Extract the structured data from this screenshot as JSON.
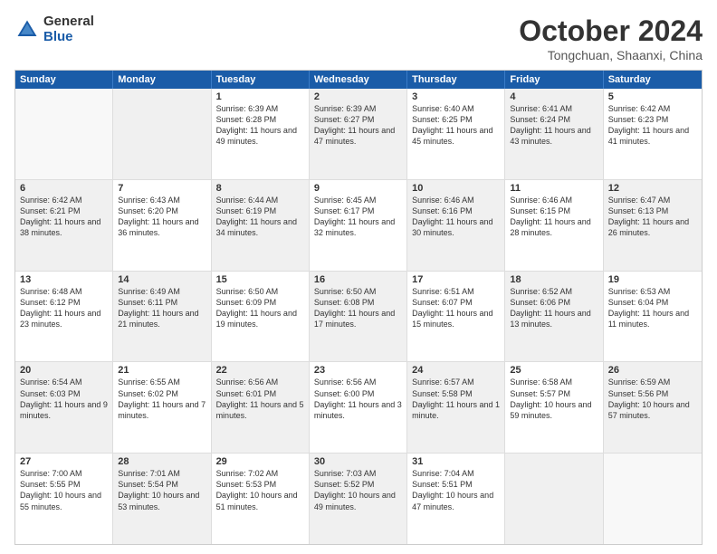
{
  "logo": {
    "general": "General",
    "blue": "Blue"
  },
  "title": {
    "month": "October 2024",
    "location": "Tongchuan, Shaanxi, China"
  },
  "days": [
    "Sunday",
    "Monday",
    "Tuesday",
    "Wednesday",
    "Thursday",
    "Friday",
    "Saturday"
  ],
  "weeks": [
    [
      {
        "date": "",
        "sunrise": "",
        "sunset": "",
        "daylight": "",
        "shaded": false
      },
      {
        "date": "",
        "sunrise": "",
        "sunset": "",
        "daylight": "",
        "shaded": true
      },
      {
        "date": "1",
        "sunrise": "Sunrise: 6:39 AM",
        "sunset": "Sunset: 6:28 PM",
        "daylight": "Daylight: 11 hours and 49 minutes.",
        "shaded": false
      },
      {
        "date": "2",
        "sunrise": "Sunrise: 6:39 AM",
        "sunset": "Sunset: 6:27 PM",
        "daylight": "Daylight: 11 hours and 47 minutes.",
        "shaded": true
      },
      {
        "date": "3",
        "sunrise": "Sunrise: 6:40 AM",
        "sunset": "Sunset: 6:25 PM",
        "daylight": "Daylight: 11 hours and 45 minutes.",
        "shaded": false
      },
      {
        "date": "4",
        "sunrise": "Sunrise: 6:41 AM",
        "sunset": "Sunset: 6:24 PM",
        "daylight": "Daylight: 11 hours and 43 minutes.",
        "shaded": true
      },
      {
        "date": "5",
        "sunrise": "Sunrise: 6:42 AM",
        "sunset": "Sunset: 6:23 PM",
        "daylight": "Daylight: 11 hours and 41 minutes.",
        "shaded": false
      }
    ],
    [
      {
        "date": "6",
        "sunrise": "Sunrise: 6:42 AM",
        "sunset": "Sunset: 6:21 PM",
        "daylight": "Daylight: 11 hours and 38 minutes.",
        "shaded": true
      },
      {
        "date": "7",
        "sunrise": "Sunrise: 6:43 AM",
        "sunset": "Sunset: 6:20 PM",
        "daylight": "Daylight: 11 hours and 36 minutes.",
        "shaded": false
      },
      {
        "date": "8",
        "sunrise": "Sunrise: 6:44 AM",
        "sunset": "Sunset: 6:19 PM",
        "daylight": "Daylight: 11 hours and 34 minutes.",
        "shaded": true
      },
      {
        "date": "9",
        "sunrise": "Sunrise: 6:45 AM",
        "sunset": "Sunset: 6:17 PM",
        "daylight": "Daylight: 11 hours and 32 minutes.",
        "shaded": false
      },
      {
        "date": "10",
        "sunrise": "Sunrise: 6:46 AM",
        "sunset": "Sunset: 6:16 PM",
        "daylight": "Daylight: 11 hours and 30 minutes.",
        "shaded": true
      },
      {
        "date": "11",
        "sunrise": "Sunrise: 6:46 AM",
        "sunset": "Sunset: 6:15 PM",
        "daylight": "Daylight: 11 hours and 28 minutes.",
        "shaded": false
      },
      {
        "date": "12",
        "sunrise": "Sunrise: 6:47 AM",
        "sunset": "Sunset: 6:13 PM",
        "daylight": "Daylight: 11 hours and 26 minutes.",
        "shaded": true
      }
    ],
    [
      {
        "date": "13",
        "sunrise": "Sunrise: 6:48 AM",
        "sunset": "Sunset: 6:12 PM",
        "daylight": "Daylight: 11 hours and 23 minutes.",
        "shaded": false
      },
      {
        "date": "14",
        "sunrise": "Sunrise: 6:49 AM",
        "sunset": "Sunset: 6:11 PM",
        "daylight": "Daylight: 11 hours and 21 minutes.",
        "shaded": true
      },
      {
        "date": "15",
        "sunrise": "Sunrise: 6:50 AM",
        "sunset": "Sunset: 6:09 PM",
        "daylight": "Daylight: 11 hours and 19 minutes.",
        "shaded": false
      },
      {
        "date": "16",
        "sunrise": "Sunrise: 6:50 AM",
        "sunset": "Sunset: 6:08 PM",
        "daylight": "Daylight: 11 hours and 17 minutes.",
        "shaded": true
      },
      {
        "date": "17",
        "sunrise": "Sunrise: 6:51 AM",
        "sunset": "Sunset: 6:07 PM",
        "daylight": "Daylight: 11 hours and 15 minutes.",
        "shaded": false
      },
      {
        "date": "18",
        "sunrise": "Sunrise: 6:52 AM",
        "sunset": "Sunset: 6:06 PM",
        "daylight": "Daylight: 11 hours and 13 minutes.",
        "shaded": true
      },
      {
        "date": "19",
        "sunrise": "Sunrise: 6:53 AM",
        "sunset": "Sunset: 6:04 PM",
        "daylight": "Daylight: 11 hours and 11 minutes.",
        "shaded": false
      }
    ],
    [
      {
        "date": "20",
        "sunrise": "Sunrise: 6:54 AM",
        "sunset": "Sunset: 6:03 PM",
        "daylight": "Daylight: 11 hours and 9 minutes.",
        "shaded": true
      },
      {
        "date": "21",
        "sunrise": "Sunrise: 6:55 AM",
        "sunset": "Sunset: 6:02 PM",
        "daylight": "Daylight: 11 hours and 7 minutes.",
        "shaded": false
      },
      {
        "date": "22",
        "sunrise": "Sunrise: 6:56 AM",
        "sunset": "Sunset: 6:01 PM",
        "daylight": "Daylight: 11 hours and 5 minutes.",
        "shaded": true
      },
      {
        "date": "23",
        "sunrise": "Sunrise: 6:56 AM",
        "sunset": "Sunset: 6:00 PM",
        "daylight": "Daylight: 11 hours and 3 minutes.",
        "shaded": false
      },
      {
        "date": "24",
        "sunrise": "Sunrise: 6:57 AM",
        "sunset": "Sunset: 5:58 PM",
        "daylight": "Daylight: 11 hours and 1 minute.",
        "shaded": true
      },
      {
        "date": "25",
        "sunrise": "Sunrise: 6:58 AM",
        "sunset": "Sunset: 5:57 PM",
        "daylight": "Daylight: 10 hours and 59 minutes.",
        "shaded": false
      },
      {
        "date": "26",
        "sunrise": "Sunrise: 6:59 AM",
        "sunset": "Sunset: 5:56 PM",
        "daylight": "Daylight: 10 hours and 57 minutes.",
        "shaded": true
      }
    ],
    [
      {
        "date": "27",
        "sunrise": "Sunrise: 7:00 AM",
        "sunset": "Sunset: 5:55 PM",
        "daylight": "Daylight: 10 hours and 55 minutes.",
        "shaded": false
      },
      {
        "date": "28",
        "sunrise": "Sunrise: 7:01 AM",
        "sunset": "Sunset: 5:54 PM",
        "daylight": "Daylight: 10 hours and 53 minutes.",
        "shaded": true
      },
      {
        "date": "29",
        "sunrise": "Sunrise: 7:02 AM",
        "sunset": "Sunset: 5:53 PM",
        "daylight": "Daylight: 10 hours and 51 minutes.",
        "shaded": false
      },
      {
        "date": "30",
        "sunrise": "Sunrise: 7:03 AM",
        "sunset": "Sunset: 5:52 PM",
        "daylight": "Daylight: 10 hours and 49 minutes.",
        "shaded": true
      },
      {
        "date": "31",
        "sunrise": "Sunrise: 7:04 AM",
        "sunset": "Sunset: 5:51 PM",
        "daylight": "Daylight: 10 hours and 47 minutes.",
        "shaded": false
      },
      {
        "date": "",
        "sunrise": "",
        "sunset": "",
        "daylight": "",
        "shaded": true
      },
      {
        "date": "",
        "sunrise": "",
        "sunset": "",
        "daylight": "",
        "shaded": false
      }
    ]
  ]
}
